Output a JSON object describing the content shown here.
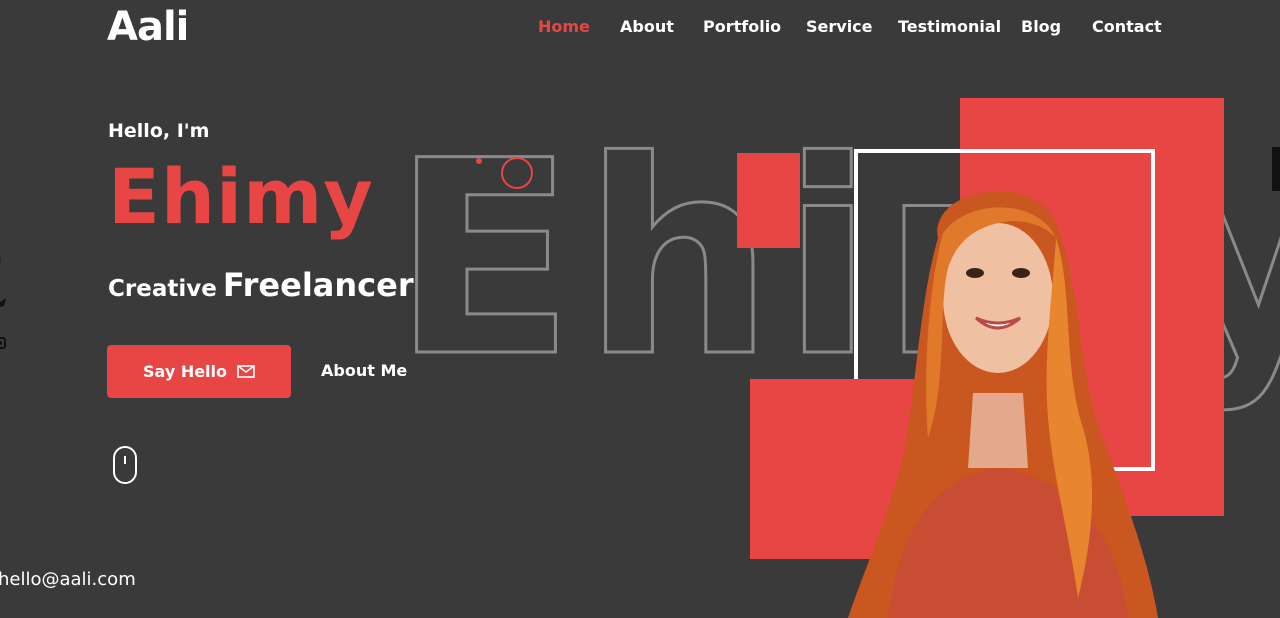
{
  "brand": {
    "logo": "Aali"
  },
  "nav": {
    "items": [
      {
        "label": "Home",
        "active": true
      },
      {
        "label": "About",
        "active": false
      },
      {
        "label": "Portfolio",
        "active": false
      },
      {
        "label": "Service",
        "active": false
      },
      {
        "label": "Testimonial",
        "active": false
      },
      {
        "label": "Blog",
        "active": false
      },
      {
        "label": "Contact",
        "active": false
      }
    ]
  },
  "social": {
    "icons": [
      "facebook-icon",
      "twitter-icon",
      "instagram-icon"
    ],
    "glyphs": [
      "f",
      "•",
      "▣"
    ]
  },
  "hero": {
    "greeting": "Hello, I'm",
    "name": "Ehimy",
    "role_prefix": "Creative",
    "role_main": "Freelancer",
    "outline_text": "Ehimy",
    "primary_button": "Say Hello",
    "secondary_link": "About Me"
  },
  "footer": {
    "email": "hello@aali.com"
  },
  "colors": {
    "accent": "#e84545",
    "background": "#3a3a3b",
    "text": "#ffffff"
  }
}
